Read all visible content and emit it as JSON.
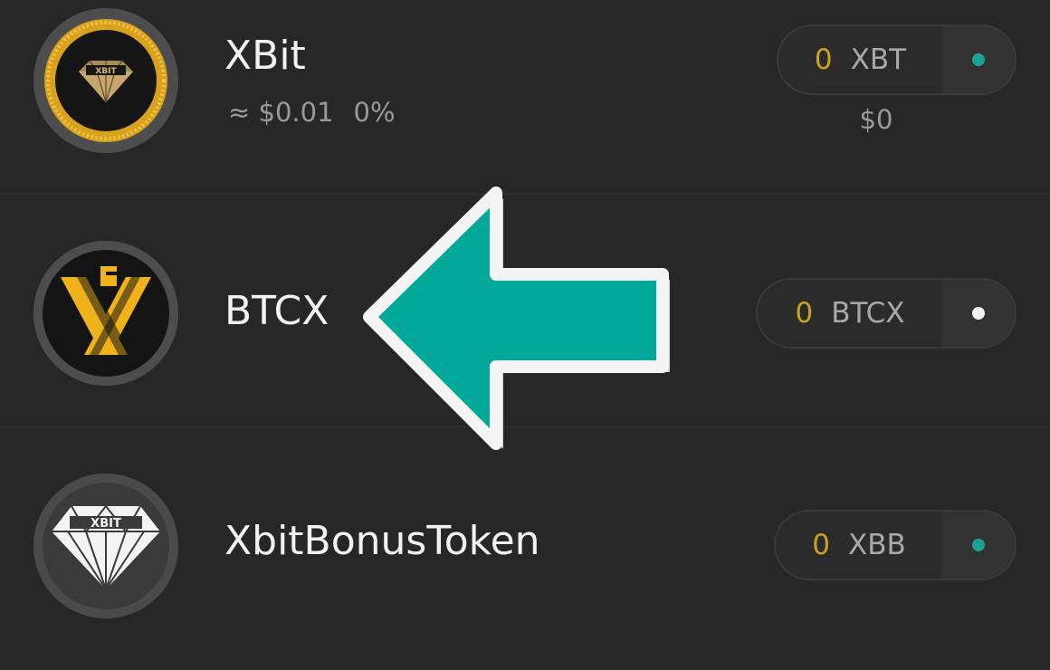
{
  "tokens": [
    {
      "name": "XBit",
      "price": "≈ $0.01",
      "change": "0%",
      "amount": "0",
      "symbol": "XBT",
      "fiat": "$0",
      "status_color": "#1aa394",
      "icon": "xbit-gold-diamond-logo"
    },
    {
      "name": "BTCX",
      "amount": "0",
      "symbol": "BTCX",
      "status_color": "#f2f2f2",
      "icon": "btcx-x-logo"
    },
    {
      "name": "XbitBonusToken",
      "amount": "0",
      "symbol": "XBB",
      "status_color": "#1aa394",
      "icon": "xbit-white-diamond-logo"
    }
  ],
  "overlay": {
    "icon": "left-arrow-icon",
    "color": "#02a89a"
  }
}
